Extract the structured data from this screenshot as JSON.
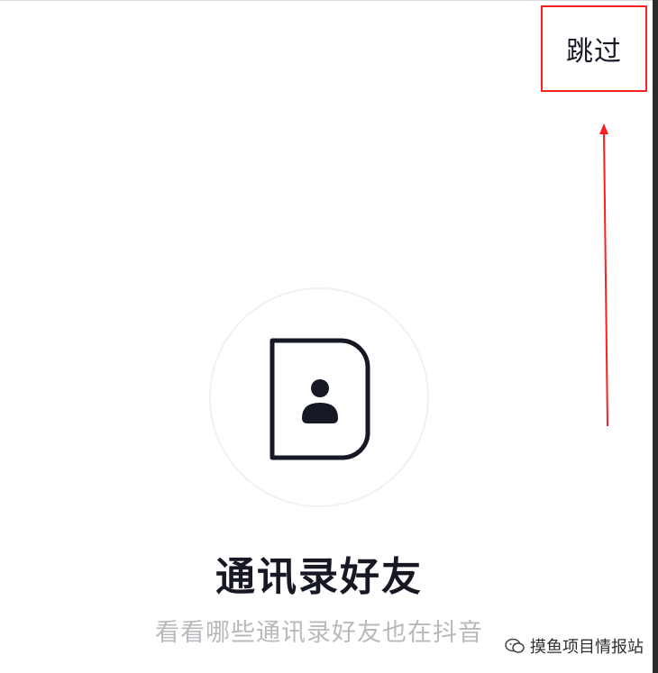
{
  "header": {
    "skip_label": "跳过"
  },
  "main": {
    "icon": "contact-book-icon",
    "title": "通讯录好友",
    "subtitle": "看看哪些通讯录好友也在抖音"
  },
  "watermark": {
    "icon": "wechat-icon",
    "text": "摸鱼项目情报站"
  },
  "colors": {
    "annotation": "#ff1f1f",
    "title": "#161823",
    "subtitle": "#b8b9bd",
    "circle_border": "#f1f1f3"
  }
}
